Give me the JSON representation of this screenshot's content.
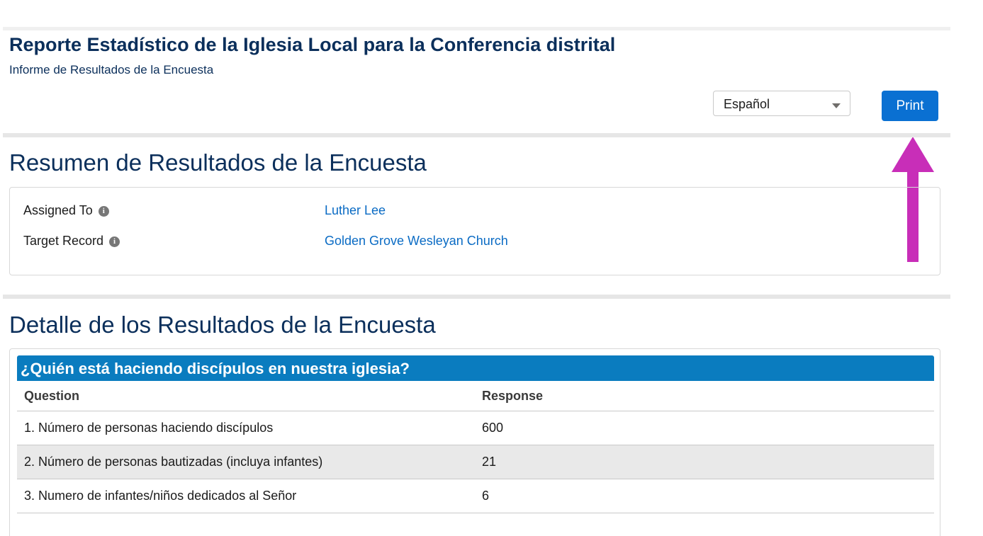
{
  "header": {
    "title": "Reporte Estadístico de la Iglesia Local para la Conferencia distrital",
    "subtitle": "Informe de Resultados de la Encuesta"
  },
  "toolbar": {
    "language_selected": "Español",
    "print_label": "Print"
  },
  "annotation": {
    "arrow_color": "#c82eb8",
    "arrow_icon": "up-arrow-icon"
  },
  "summary": {
    "title": "Resumen de Resultados de la Encuesta",
    "fields": [
      {
        "label": "Assigned To",
        "value": "Luther Lee"
      },
      {
        "label": "Target Record",
        "value": "Golden Grove Wesleyan Church"
      }
    ]
  },
  "detail": {
    "title": "Detalle de los Resultados de la Encuesta",
    "group_title": "¿Quién está haciendo discípulos en nuestra iglesia?",
    "columns": {
      "question": "Question",
      "response": "Response"
    },
    "rows": [
      {
        "question": "1. Número de personas haciendo discípulos",
        "response": "600"
      },
      {
        "question": "2. Número de personas bautizadas (incluya infantes)",
        "response": "21"
      },
      {
        "question": "3. Numero de infantes/niños dedicados al Señor",
        "response": "6"
      }
    ]
  },
  "colors": {
    "accent": "#0a70d2",
    "group_header": "#0a7cbf",
    "link": "#0a6bc4",
    "title": "#0b2f5b"
  }
}
